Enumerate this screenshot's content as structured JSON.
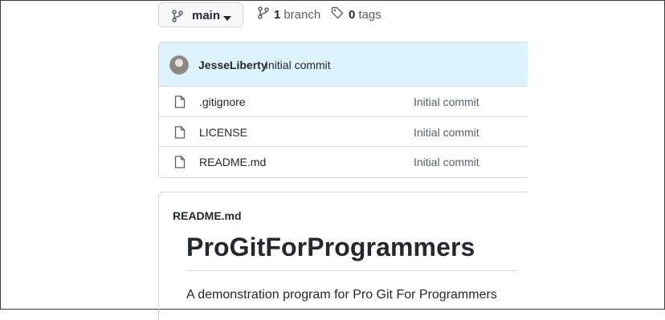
{
  "toolbar": {
    "branch_button_label": "main",
    "branch_count": "1",
    "branch_label": "branch",
    "tag_count": "0",
    "tag_label": "tags"
  },
  "latest_commit": {
    "author": "JesseLiberty",
    "message": "Initial commit"
  },
  "files": [
    {
      "name": ".gitignore",
      "commit": "Initial commit",
      "icon": "file-icon"
    },
    {
      "name": "LICENSE",
      "commit": "Initial commit",
      "icon": "file-icon"
    },
    {
      "name": "README.md",
      "commit": "Initial commit",
      "icon": "file-icon"
    }
  ],
  "readme": {
    "label": "README.md",
    "title": "ProGitForProgrammers",
    "description": "A demonstration program for Pro Git For Programmers"
  },
  "colors": {
    "commit_bar_bg": "#ddf4ff",
    "border": "#d0d7de",
    "muted_text": "#57606a"
  }
}
